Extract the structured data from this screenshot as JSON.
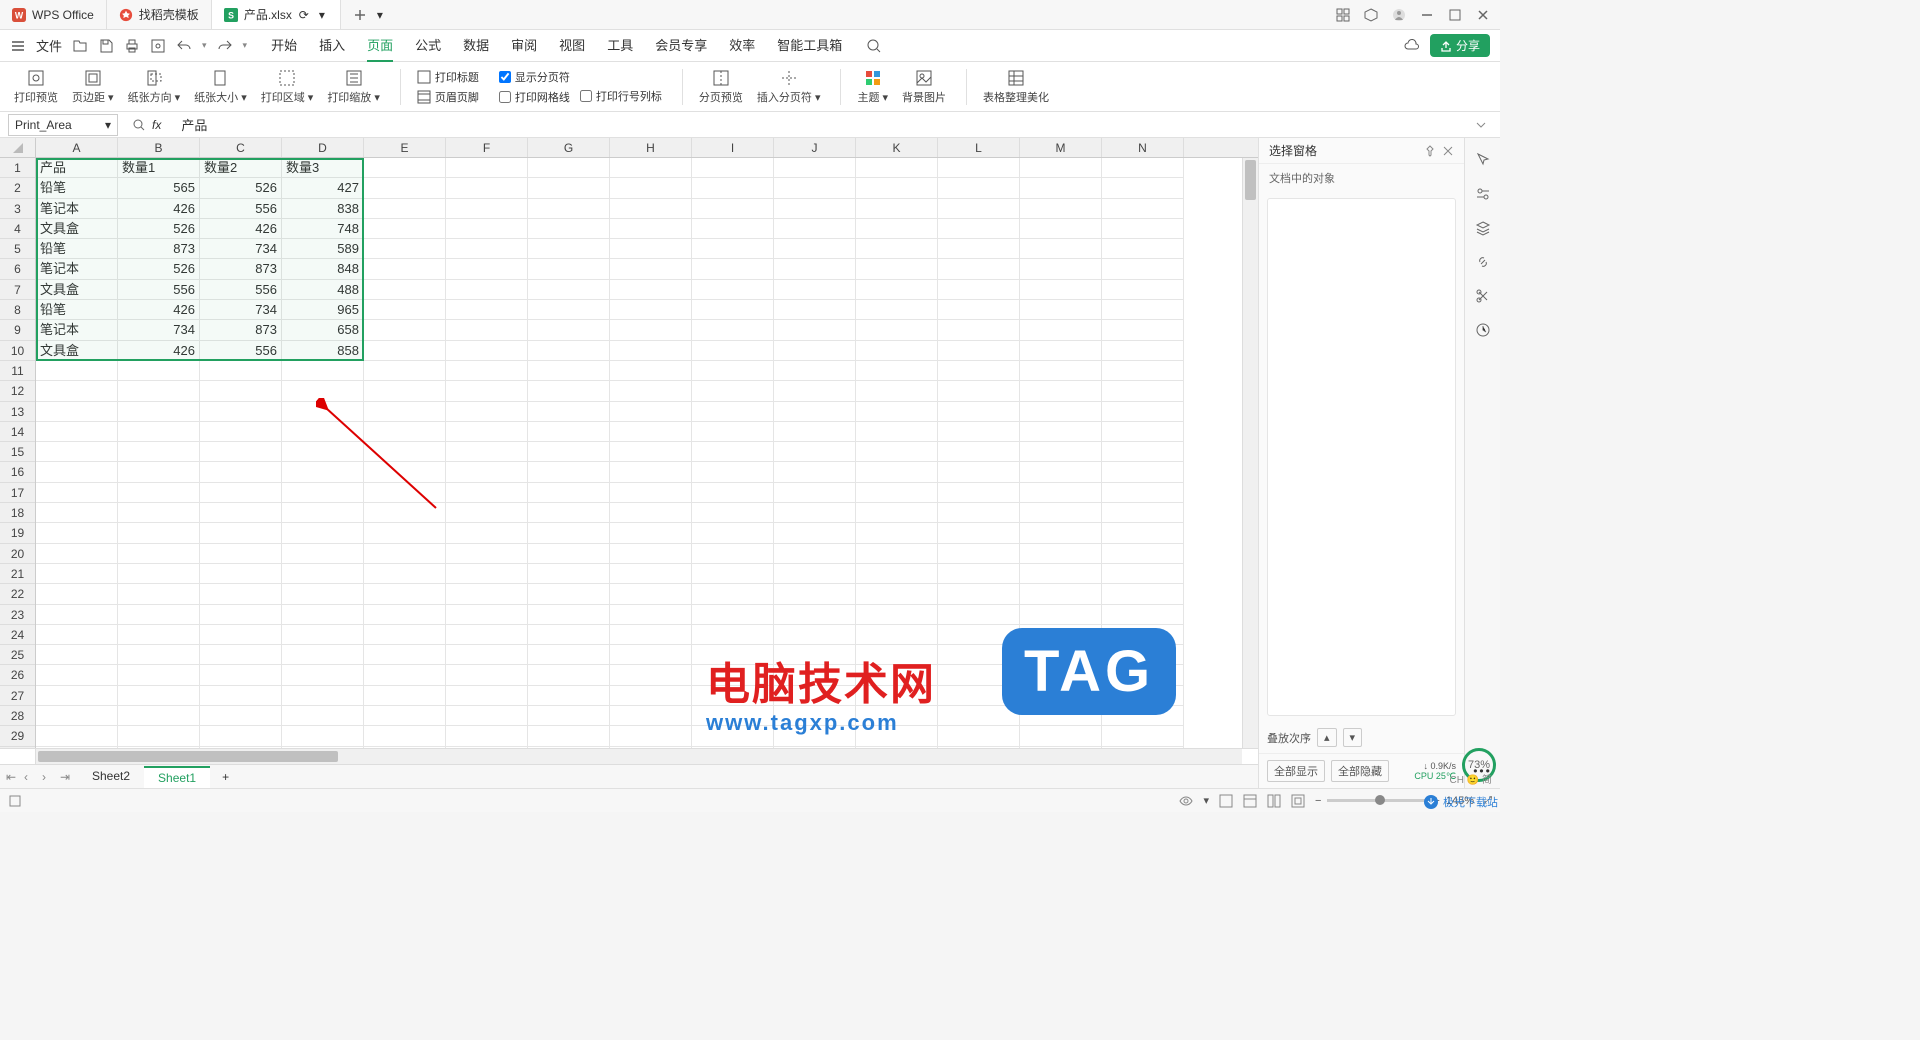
{
  "titlebar": {
    "app_name": "WPS Office",
    "tabs": [
      {
        "label": "找稻壳模板",
        "icon": "template-icon"
      },
      {
        "label": "产品.xlsx",
        "icon": "sheet-icon",
        "active": true
      }
    ]
  },
  "menubar": {
    "file_label": "文件",
    "tabs": [
      "开始",
      "插入",
      "页面",
      "公式",
      "数据",
      "审阅",
      "视图",
      "工具",
      "会员专享",
      "效率",
      "智能工具箱"
    ],
    "active_tab": "页面",
    "share_label": "分享"
  },
  "ribbon": {
    "print_preview": "打印预览",
    "margins": "页边距",
    "orientation": "纸张方向",
    "size": "纸张大小",
    "print_area": "打印区域",
    "print_scale": "打印缩放",
    "print_title": "打印标题",
    "header_footer": "页眉页脚",
    "show_page_break": "显示分页符",
    "print_gridlines": "打印网格线",
    "print_row_col": "打印行号列标",
    "page_break_preview": "分页预览",
    "insert_break": "插入分页符",
    "theme": "主题",
    "bg_image": "背景图片",
    "table_style": "表格整理美化"
  },
  "formula_bar": {
    "name_box": "Print_Area",
    "formula_value": "产品"
  },
  "grid": {
    "columns": [
      "A",
      "B",
      "C",
      "D",
      "E",
      "F",
      "G",
      "H",
      "I",
      "J",
      "K",
      "L",
      "M",
      "N"
    ],
    "row_count": 30,
    "headers": [
      "产品",
      "数量1",
      "数量2",
      "数量3"
    ],
    "data": [
      [
        "铅笔",
        565,
        526,
        427
      ],
      [
        "笔记本",
        426,
        556,
        838
      ],
      [
        "文具盒",
        526,
        426,
        748
      ],
      [
        "铅笔",
        873,
        734,
        589
      ],
      [
        "笔记本",
        526,
        873,
        848
      ],
      [
        "文具盒",
        556,
        556,
        488
      ],
      [
        "铅笔",
        426,
        734,
        965
      ],
      [
        "笔记本",
        734,
        873,
        658
      ],
      [
        "文具盒",
        426,
        556,
        858
      ]
    ]
  },
  "pane": {
    "title": "选择窗格",
    "subtitle": "文档中的对象",
    "order_label": "叠放次序",
    "show_all": "全部显示",
    "hide_all": "全部隐藏"
  },
  "sheets": {
    "tabs": [
      "Sheet2",
      "Sheet1"
    ],
    "active": "Sheet1"
  },
  "statusbar": {
    "zoom_value": "145%"
  },
  "watermark": {
    "title": "电脑技术网",
    "url": "www.tagxp.com",
    "tag": "TAG"
  },
  "float": {
    "cpu_pct": "73%",
    "net_speed": "0.9K/s",
    "cpu_temp": "CPU 25℃",
    "ime": "CH 🙂 简"
  },
  "download_badge": "极光下载站"
}
